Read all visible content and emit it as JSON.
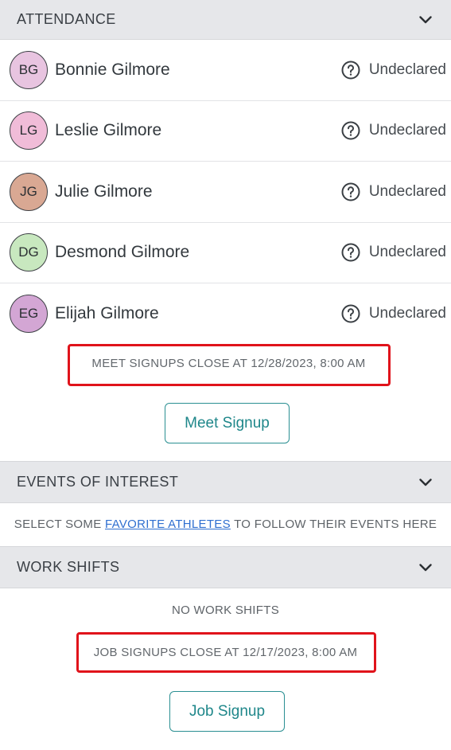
{
  "attendance": {
    "title": "ATTENDANCE",
    "athletes": [
      {
        "initials": "BG",
        "name": "Bonnie Gilmore",
        "status": "Undeclared",
        "color": "#e8c4e0"
      },
      {
        "initials": "LG",
        "name": "Leslie Gilmore",
        "status": "Undeclared",
        "color": "#f0bcd8"
      },
      {
        "initials": "JG",
        "name": "Julie Gilmore",
        "status": "Undeclared",
        "color": "#d9a893"
      },
      {
        "initials": "DG",
        "name": "Desmond Gilmore",
        "status": "Undeclared",
        "color": "#c8e8bf"
      },
      {
        "initials": "EG",
        "name": "Elijah Gilmore",
        "status": "Undeclared",
        "color": "#d3a6d4"
      }
    ],
    "signup_notice": "MEET SIGNUPS CLOSE AT 12/28/2023, 8:00 AM",
    "signup_button": "Meet Signup"
  },
  "events": {
    "title": "EVENTS OF INTEREST",
    "text_before": "SELECT SOME ",
    "link_text": "FAVORITE ATHLETES",
    "text_after": " TO FOLLOW THEIR EVENTS HERE"
  },
  "shifts": {
    "title": "WORK SHIFTS",
    "empty_text": "NO WORK SHIFTS",
    "signup_notice": "JOB SIGNUPS CLOSE AT 12/17/2023, 8:00 AM",
    "signup_button": "Job Signup"
  },
  "colors": {
    "accent": "#2a8f92",
    "highlight": "#e0131b",
    "link": "#2f6fd0",
    "header_bg": "#e6e7ea"
  }
}
